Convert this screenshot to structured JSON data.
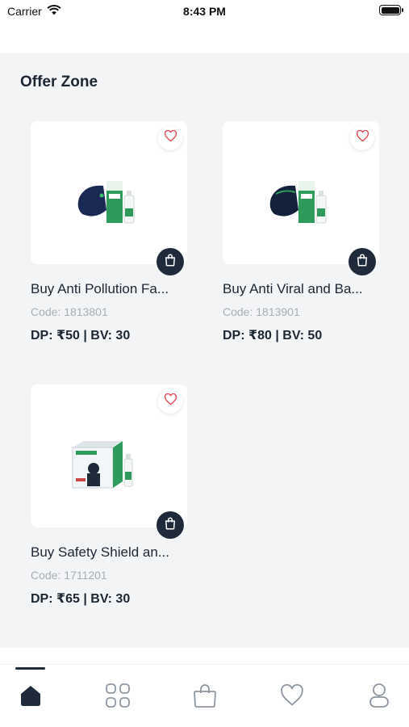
{
  "status_bar": {
    "carrier": "Carrier",
    "time": "8:43 PM"
  },
  "section": {
    "title": "Offer Zone"
  },
  "products": [
    {
      "title": "Buy Anti Pollution Fa...",
      "code": "Code: 1813801",
      "price": "DP: ₹50 | BV: 30",
      "image_icon": "mask-and-spray-product-image"
    },
    {
      "title": "Buy Anti Viral and Ba...",
      "code": "Code: 1813901",
      "price": "DP: ₹80 | BV: 50",
      "image_icon": "mask-and-spray-product-image"
    },
    {
      "title": "Buy Safety Shield an...",
      "code": "Code: 1711201",
      "price": "DP: ₹65 | BV: 30",
      "image_icon": "safety-shield-box-product-image"
    }
  ],
  "bottom_nav": {
    "items": [
      "home-icon",
      "categories-icon",
      "bag-icon",
      "heart-icon",
      "profile-icon"
    ],
    "active": "home-icon"
  },
  "colors": {
    "accent_dark": "#1f2b3a",
    "heart": "#e0464f",
    "background": "#f3f4f6",
    "product_green": "#2e9a5c"
  }
}
